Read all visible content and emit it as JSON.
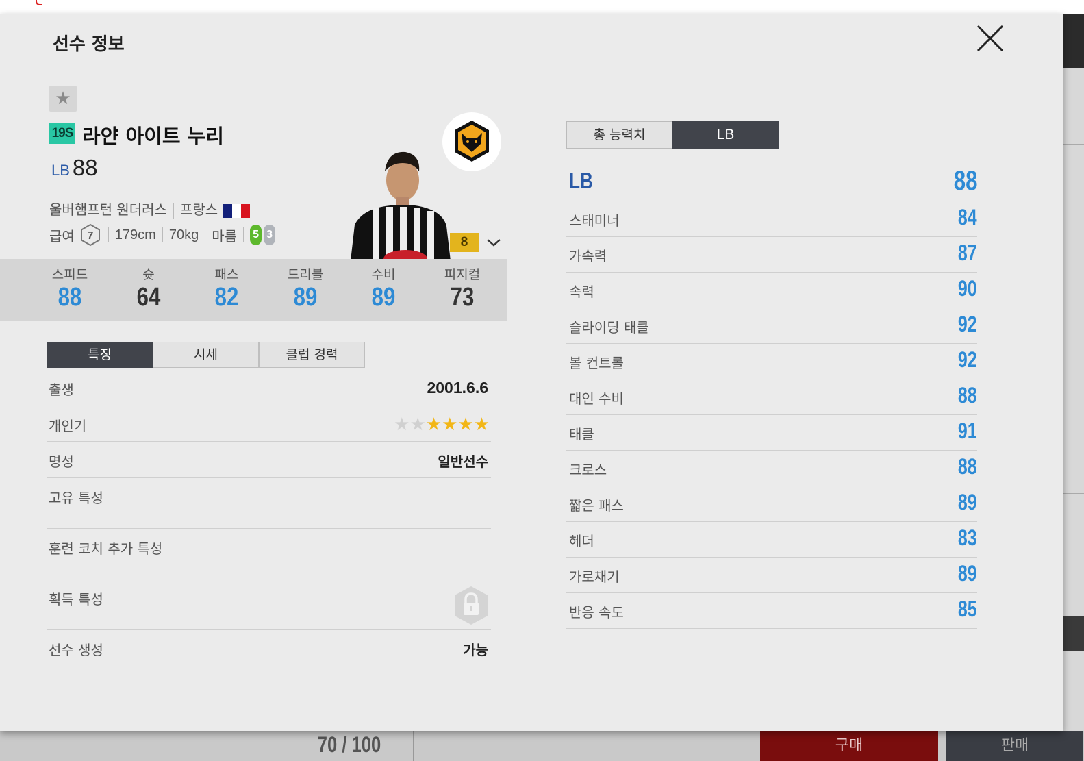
{
  "modal": {
    "title": "선수 정보"
  },
  "player": {
    "season": "19S",
    "name": "라얀 아이트 누리",
    "position": "LB",
    "overall": "88",
    "club": "울버햄프턴 원더러스",
    "nation": "프랑스",
    "salary_label": "급여",
    "salary": "7",
    "height": "179cm",
    "weight": "70kg",
    "body_type": "마름",
    "left_foot": "5",
    "right_foot": "3",
    "enhance_level": "8"
  },
  "summary_stats": [
    {
      "label": "스피드",
      "value": "88"
    },
    {
      "label": "슛",
      "value": "64"
    },
    {
      "label": "패스",
      "value": "82"
    },
    {
      "label": "드리블",
      "value": "89"
    },
    {
      "label": "수비",
      "value": "89"
    },
    {
      "label": "피지컬",
      "value": "73"
    }
  ],
  "tabs": {
    "traits": "특징",
    "price": "시세",
    "club_history": "클럽 경력"
  },
  "info": {
    "birth_label": "출생",
    "birth": "2001.6.6",
    "popularity_label": "개인기",
    "popularity_stars": 4,
    "popularity_max": 6,
    "reputation_label": "명성",
    "reputation": "일반선수",
    "unique_traits_label": "고유 특성",
    "coach_traits_label": "훈련 코치 추가 특성",
    "acquired_traits_label": "획득 특성",
    "creation_label": "선수 생성",
    "creation": "가능"
  },
  "right_tabs": {
    "overall": "총 능력치",
    "position": "LB"
  },
  "attributes": {
    "head": {
      "label": "LB",
      "value": "88"
    },
    "rows": [
      {
        "label": "스태미너",
        "value": "84"
      },
      {
        "label": "가속력",
        "value": "87"
      },
      {
        "label": "속력",
        "value": "90"
      },
      {
        "label": "슬라이딩 태클",
        "value": "92"
      },
      {
        "label": "볼 컨트롤",
        "value": "92"
      },
      {
        "label": "대인 수비",
        "value": "88"
      },
      {
        "label": "태클",
        "value": "91"
      },
      {
        "label": "크로스",
        "value": "88"
      },
      {
        "label": "짧은 패스",
        "value": "89"
      },
      {
        "label": "헤더",
        "value": "83"
      },
      {
        "label": "가로채기",
        "value": "89"
      },
      {
        "label": "반응 속도",
        "value": "85"
      }
    ]
  },
  "background": {
    "count": "70 / 100",
    "buy": "구매",
    "sell": "판매"
  },
  "colors": {
    "accent_blue": "#2d8ad5",
    "position_blue": "#2a5aa7",
    "season_badge": "#29c7a4",
    "tab_dark": "#41444b",
    "buy_red": "#7a0d0d"
  }
}
